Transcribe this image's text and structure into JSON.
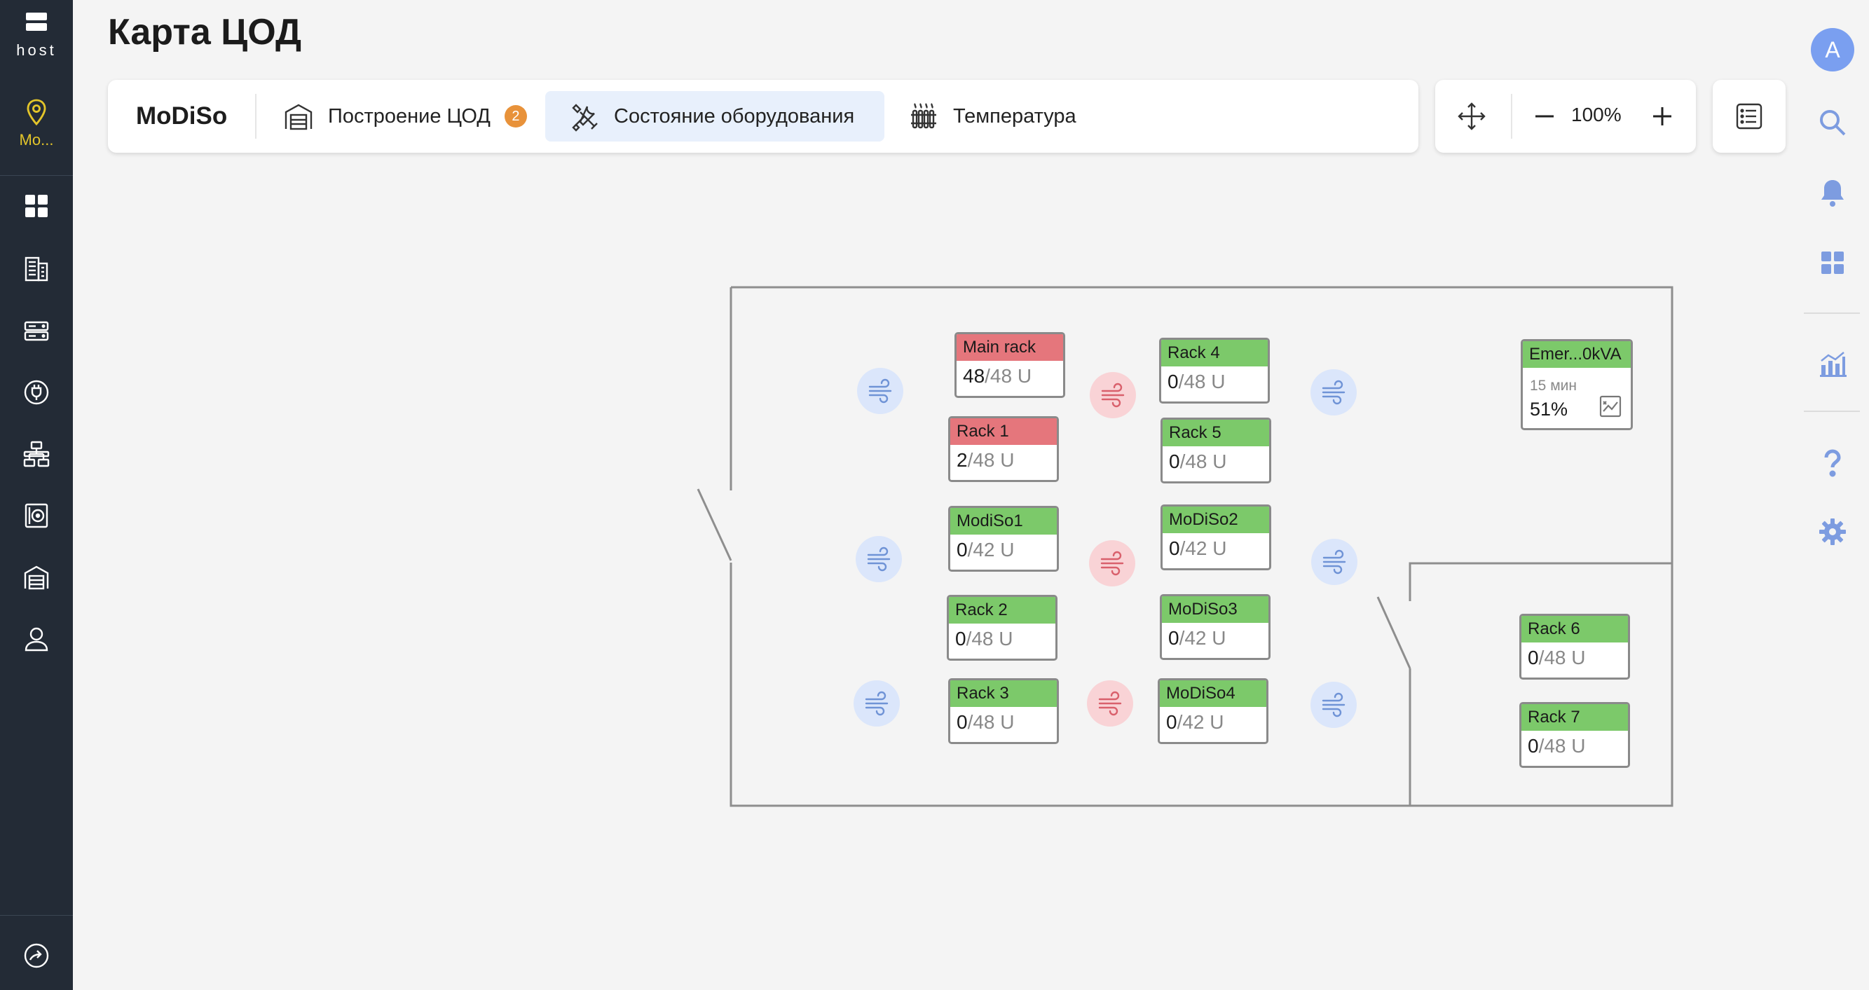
{
  "sidebar": {
    "logo_text": "host",
    "location_label": "Mo...",
    "nav": [
      {
        "icon": "dashboard-icon"
      },
      {
        "icon": "building-icon"
      },
      {
        "icon": "server-icon"
      },
      {
        "icon": "power-plug-icon"
      },
      {
        "icon": "network-icon"
      },
      {
        "icon": "disk-icon"
      },
      {
        "icon": "warehouse-icon"
      },
      {
        "icon": "user-icon"
      }
    ],
    "bottom_icon": "expand-icon"
  },
  "page": {
    "title": "Карта ЦОД"
  },
  "toolbar": {
    "site_name": "MoDiSo",
    "tabs": [
      {
        "label": "Построение ЦОД",
        "icon": "warehouse-icon",
        "badge": "2",
        "active": false
      },
      {
        "label": "Состояние оборудования",
        "icon": "tools-icon",
        "active": true
      },
      {
        "label": "Температура",
        "icon": "radiator-icon",
        "active": false
      }
    ],
    "zoom": "100%"
  },
  "user": {
    "avatar_letter": "A"
  },
  "rail": [
    "search-icon",
    "bell-icon",
    "grid-icon",
    "chart-icon",
    "help-icon",
    "settings-icon"
  ],
  "colors": {
    "ok": "#7cc96a",
    "alert": "#e5767c",
    "cold": "#dbe6fb",
    "hot": "#f9d3d6",
    "accent": "#e8923a",
    "sidebar": "#232b36"
  },
  "racks": [
    {
      "name": "Main rack",
      "used": "48",
      "total": "/48 U",
      "status": "red"
    },
    {
      "name": "Rack 1",
      "used": "2",
      "total": "/48 U",
      "status": "red"
    },
    {
      "name": "ModiSo1",
      "used": "0",
      "total": "/42 U",
      "status": "green"
    },
    {
      "name": "Rack 2",
      "used": "0",
      "total": "/48 U",
      "status": "green"
    },
    {
      "name": "Rack 3",
      "used": "0",
      "total": "/48 U",
      "status": "green"
    },
    {
      "name": "Rack 4",
      "used": "0",
      "total": "/48 U",
      "status": "green"
    },
    {
      "name": "Rack 5",
      "used": "0",
      "total": "/48 U",
      "status": "green"
    },
    {
      "name": "MoDiSo2",
      "used": "0",
      "total": "/42 U",
      "status": "green"
    },
    {
      "name": "MoDiSo3",
      "used": "0",
      "total": "/42 U",
      "status": "green"
    },
    {
      "name": "MoDiSo4",
      "used": "0",
      "total": "/42 U",
      "status": "green"
    },
    {
      "name": "Rack 6",
      "used": "0",
      "total": "/48 U",
      "status": "green"
    },
    {
      "name": "Rack 7",
      "used": "0",
      "total": "/48 U",
      "status": "green"
    }
  ],
  "ups": {
    "name": "Emer...0kVA",
    "time": "15 мин",
    "charge": "51%",
    "status": "green"
  },
  "airflow": [
    {
      "type": "cold"
    },
    {
      "type": "cold"
    },
    {
      "type": "cold"
    },
    {
      "type": "hot"
    },
    {
      "type": "hot"
    },
    {
      "type": "hot"
    },
    {
      "type": "cold"
    },
    {
      "type": "cold"
    },
    {
      "type": "cold"
    }
  ]
}
